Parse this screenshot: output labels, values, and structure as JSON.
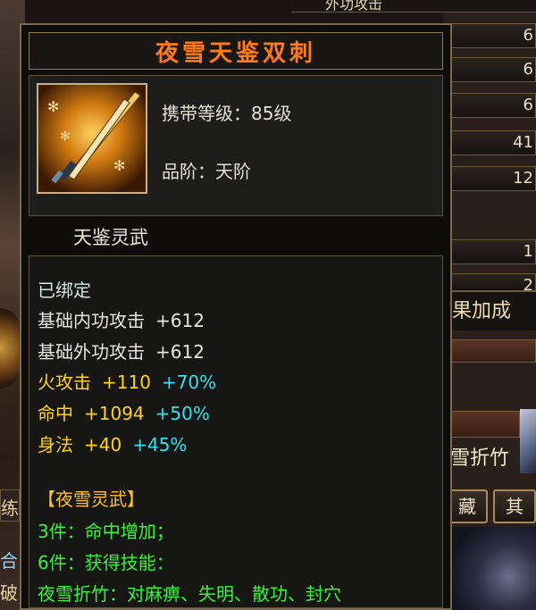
{
  "background": {
    "stat_top": "外功攻击",
    "stat_values": [
      "6",
      "6",
      "6",
      "41",
      "12",
      "1",
      "2"
    ],
    "effect_header": "果加成",
    "skill_label": "雪折竹",
    "tabs": [
      "藏",
      "其"
    ],
    "left_texts": [
      "练",
      "合",
      "破"
    ]
  },
  "tooltip": {
    "title": "夜雪天鉴双刺",
    "carry_level_label": "携带等级：85级",
    "grade_label": "品阶：天阶",
    "subtitle": "天鉴灵武",
    "bound": "已绑定",
    "attributes": [
      {
        "name": "基础内功攻击",
        "value": "+612",
        "bonus": ""
      },
      {
        "name": "基础外功攻击",
        "value": "+612",
        "bonus": ""
      },
      {
        "name": "火攻击",
        "value": "+110",
        "bonus": "+70%"
      },
      {
        "name": "命中",
        "value": "+1094",
        "bonus": "+50%"
      },
      {
        "name": "身法",
        "value": "+40",
        "bonus": "+45%"
      }
    ],
    "set_name": "【夜雪灵武】",
    "set_bonuses": [
      "3件：命中增加；",
      "6件：获得技能：",
      "夜雪折竹：对麻痹、失明、散功、封穴"
    ],
    "icon": "twin-daggers-icon"
  }
}
